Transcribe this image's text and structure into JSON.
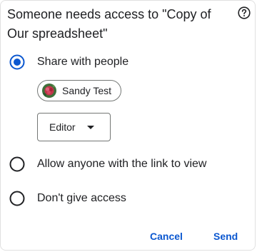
{
  "dialog": {
    "title": "Someone needs access to \"Copy of Our spreadsheet\"",
    "help_icon": "help-circle-icon"
  },
  "options": [
    {
      "label": "Share with people",
      "selected": true
    },
    {
      "label": "Allow anyone with the link to view",
      "selected": false
    },
    {
      "label": "Don't give access",
      "selected": false
    }
  ],
  "recipient": {
    "name": "Sandy Test",
    "avatar_icon": "flower-avatar-icon"
  },
  "role": {
    "value": "Editor",
    "options": [
      "Editor"
    ]
  },
  "buttons": {
    "cancel": "Cancel",
    "send": "Send"
  },
  "colors": {
    "accent": "#0b57d0",
    "text": "#202124",
    "outline": "#747775"
  }
}
